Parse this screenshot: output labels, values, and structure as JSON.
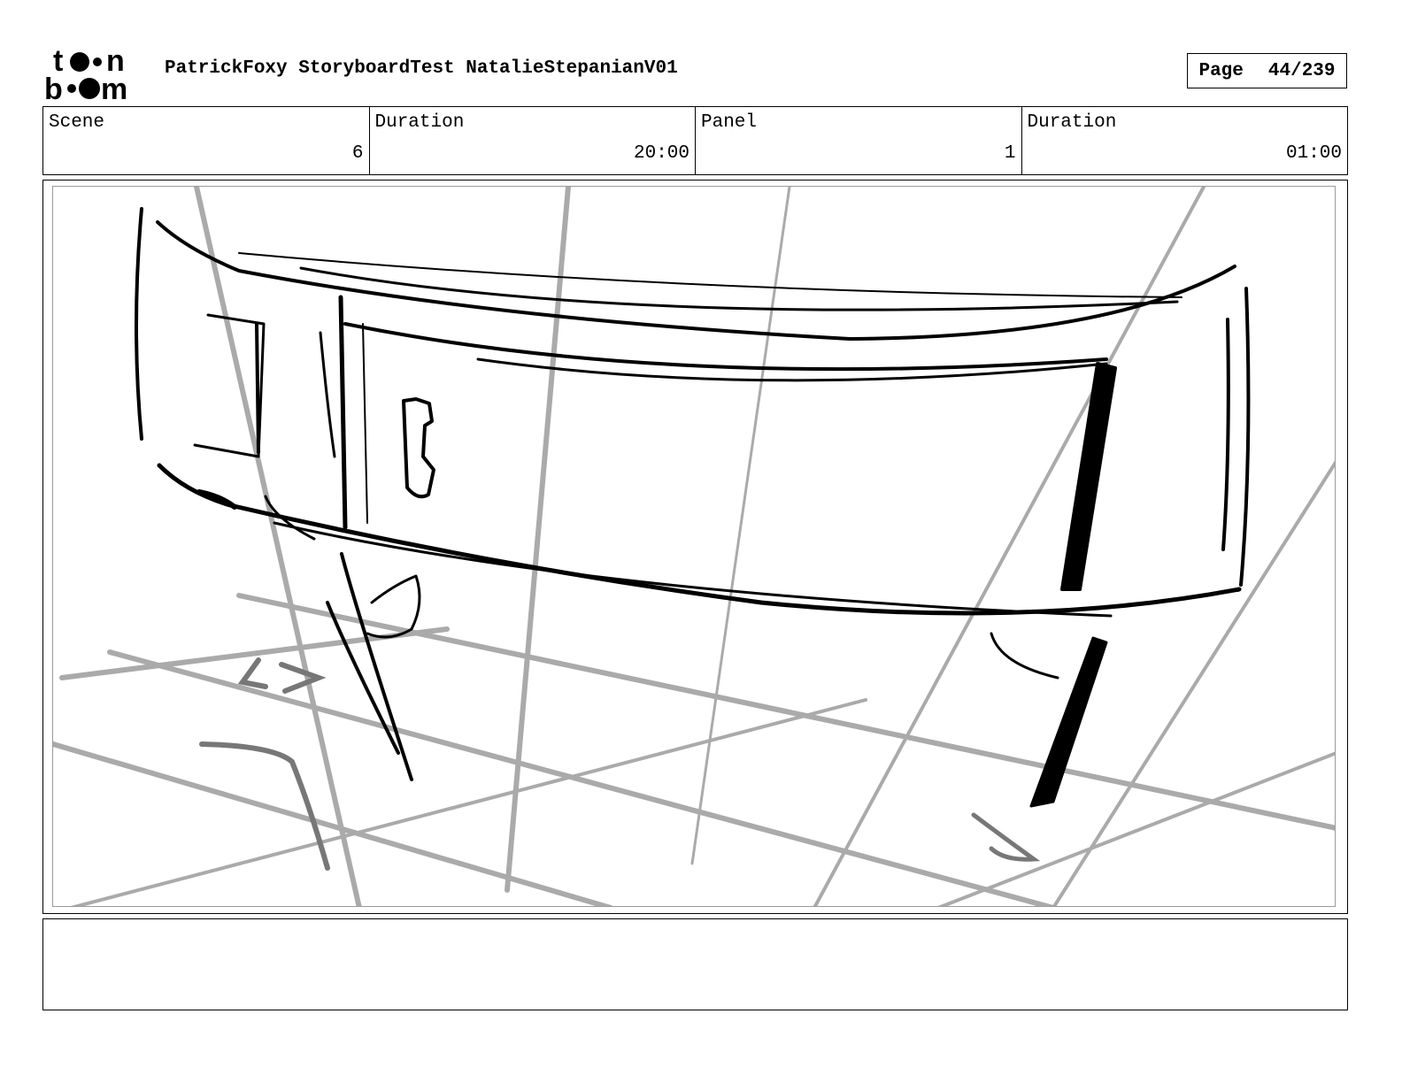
{
  "header": {
    "logo": {
      "brand": "toon boom",
      "line1": "toon",
      "line2": "boom"
    },
    "title": "PatrickFoxy StoryboardTest NatalieStepanianV01",
    "page_label": "Page",
    "page_number": "44/239"
  },
  "info": [
    {
      "label": "Scene",
      "value": "6"
    },
    {
      "label": "Duration",
      "value": "20:00"
    },
    {
      "label": "Panel",
      "value": "1"
    },
    {
      "label": "Duration",
      "value": "01:00"
    }
  ],
  "panel": {
    "drawing": "storyboard-sketch-curved-dresser",
    "colors": {
      "ink": "#000000",
      "guide_lines": "#aaaaaa",
      "frame": "#9a9a9a"
    }
  },
  "notes": {
    "text": ""
  }
}
